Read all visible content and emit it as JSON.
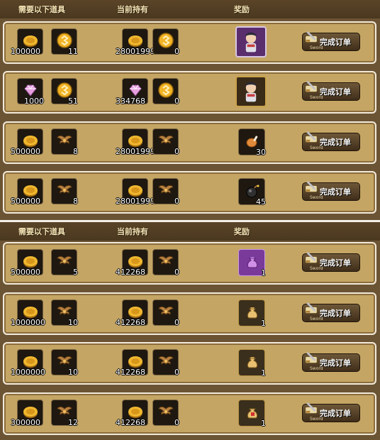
{
  "headers": {
    "need": "需要以下道具",
    "have": "当前持有",
    "reward": "奖励"
  },
  "button": {
    "label": "完成订单",
    "sub": "Sword"
  },
  "rows": [
    {
      "need": [
        {
          "icon": "gold-coin-icon",
          "count": "100000"
        },
        {
          "icon": "gold-token-icon",
          "count": "11"
        }
      ],
      "have": [
        {
          "icon": "gold-coin-icon",
          "count": "28001999"
        },
        {
          "icon": "gold-token-icon",
          "count": "0"
        }
      ],
      "reward": {
        "icon": "hero-portrait-icon",
        "count": ""
      }
    },
    {
      "need": [
        {
          "icon": "pink-gem-icon",
          "count": "1000"
        },
        {
          "icon": "gold-token-icon",
          "count": "51"
        }
      ],
      "have": [
        {
          "icon": "pink-gem-icon",
          "count": "334768"
        },
        {
          "icon": "gold-token-icon",
          "count": "0"
        }
      ],
      "reward": {
        "icon": "hero-portrait-icon",
        "count": ""
      }
    },
    {
      "need": [
        {
          "icon": "gold-coin-icon",
          "count": "500000"
        },
        {
          "icon": "winged-emblem-icon",
          "count": "8"
        }
      ],
      "have": [
        {
          "icon": "gold-coin-icon",
          "count": "28001999"
        },
        {
          "icon": "winged-emblem-icon",
          "count": "0"
        }
      ],
      "reward": {
        "icon": "meat-icon",
        "count": "30"
      }
    },
    {
      "need": [
        {
          "icon": "gold-coin-icon",
          "count": "500000"
        },
        {
          "icon": "winged-emblem-icon",
          "count": "8"
        }
      ],
      "have": [
        {
          "icon": "gold-coin-icon",
          "count": "28001999"
        },
        {
          "icon": "winged-emblem-icon",
          "count": "0"
        }
      ],
      "reward": {
        "icon": "bomb-icon",
        "count": "45"
      }
    },
    {
      "need": [
        {
          "icon": "gold-coin-icon",
          "count": "500000"
        },
        {
          "icon": "winged-emblem-icon",
          "count": "5"
        }
      ],
      "have": [
        {
          "icon": "gold-coin-icon",
          "count": "412268"
        },
        {
          "icon": "winged-emblem-icon",
          "count": "0"
        }
      ],
      "reward": {
        "icon": "purple-bag-icon",
        "count": "1"
      }
    },
    {
      "need": [
        {
          "icon": "gold-coin-icon",
          "count": "1000000"
        },
        {
          "icon": "winged-emblem-icon",
          "count": "10"
        }
      ],
      "have": [
        {
          "icon": "gold-coin-icon",
          "count": "412268"
        },
        {
          "icon": "winged-emblem-icon",
          "count": "0"
        }
      ],
      "reward": {
        "icon": "gold-bag-icon",
        "count": "1"
      }
    },
    {
      "need": [
        {
          "icon": "gold-coin-icon",
          "count": "1000000"
        },
        {
          "icon": "winged-emblem-icon",
          "count": "10"
        }
      ],
      "have": [
        {
          "icon": "gold-coin-icon",
          "count": "412268"
        },
        {
          "icon": "winged-emblem-icon",
          "count": "0"
        }
      ],
      "reward": {
        "icon": "gold-bag-icon",
        "count": "1"
      }
    },
    {
      "need": [
        {
          "icon": "gold-coin-icon",
          "count": "300000"
        },
        {
          "icon": "winged-emblem-icon",
          "count": "12"
        }
      ],
      "have": [
        {
          "icon": "gold-coin-icon",
          "count": "412268"
        },
        {
          "icon": "winged-emblem-icon",
          "count": "0"
        }
      ],
      "reward": {
        "icon": "gift-bag-icon",
        "count": "1"
      }
    }
  ]
}
